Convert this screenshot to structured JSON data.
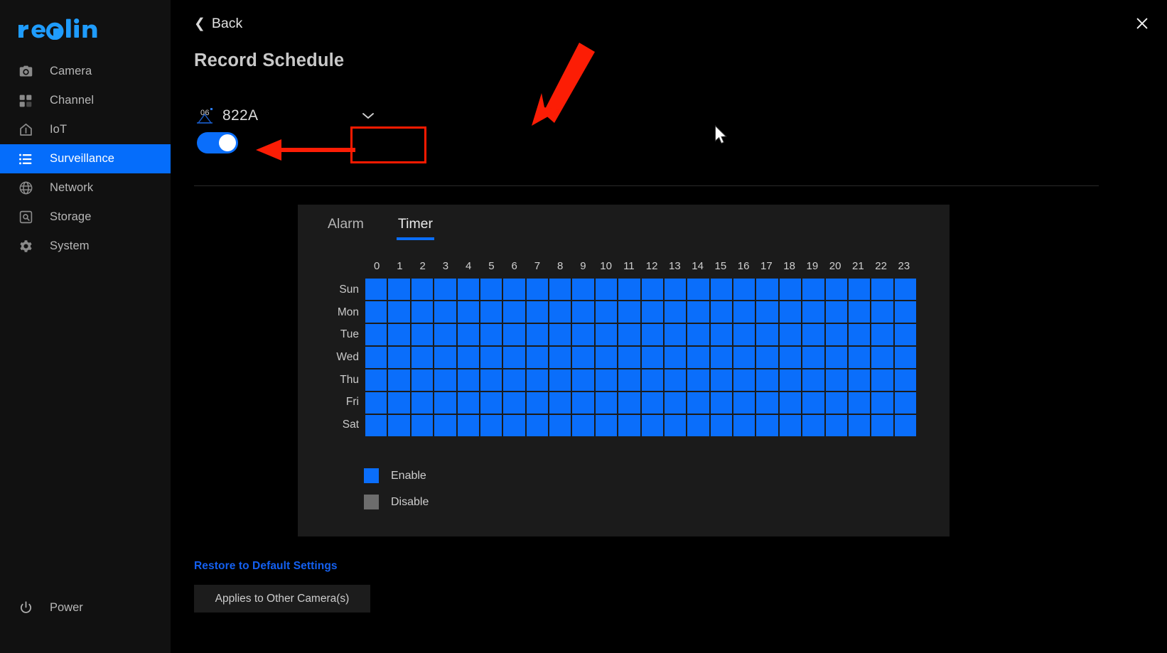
{
  "brand": {
    "name": "reolink",
    "color": "#1f9cfd"
  },
  "sidebar": {
    "items": [
      {
        "label": "Camera",
        "icon": "camera-icon",
        "active": false
      },
      {
        "label": "Channel",
        "icon": "channel-grid-icon",
        "active": false
      },
      {
        "label": "IoT",
        "icon": "home-iot-icon",
        "active": false
      },
      {
        "label": "Surveillance",
        "icon": "list-icon",
        "active": true
      },
      {
        "label": "Network",
        "icon": "globe-icon",
        "active": false
      },
      {
        "label": "Storage",
        "icon": "hard-disk-icon",
        "active": false
      },
      {
        "label": "System",
        "icon": "gear-icon",
        "active": false
      }
    ],
    "power": {
      "label": "Power",
      "icon": "power-icon"
    }
  },
  "header": {
    "back_label": "Back",
    "back_icon": "chevron-left-icon",
    "title": "Record Schedule",
    "close_icon": "close-icon"
  },
  "camera_selector": {
    "channel_number": "06",
    "channel_icon": "camera-channel-icon",
    "camera_name": "822A",
    "dropdown_icon": "chevron-down-icon",
    "enabled": true
  },
  "schedule": {
    "tabs": [
      {
        "label": "Alarm",
        "active": false
      },
      {
        "label": "Timer",
        "active": true
      }
    ],
    "active_color": "#0a6efb",
    "legend": [
      {
        "label": "Enable",
        "color": "#0a6efb"
      },
      {
        "label": "Disable",
        "color": "#6d6d6d"
      }
    ],
    "hours": [
      "0",
      "1",
      "2",
      "3",
      "4",
      "5",
      "6",
      "7",
      "8",
      "9",
      "10",
      "11",
      "12",
      "13",
      "14",
      "15",
      "16",
      "17",
      "18",
      "19",
      "20",
      "21",
      "22",
      "23"
    ],
    "days": [
      "Sun",
      "Mon",
      "Tue",
      "Wed",
      "Thu",
      "Fri",
      "Sat"
    ],
    "cells": [
      [
        1,
        1,
        1,
        1,
        1,
        1,
        1,
        1,
        1,
        1,
        1,
        1,
        1,
        1,
        1,
        1,
        1,
        1,
        1,
        1,
        1,
        1,
        1,
        1
      ],
      [
        1,
        1,
        1,
        1,
        1,
        1,
        1,
        1,
        1,
        1,
        1,
        1,
        1,
        1,
        1,
        1,
        1,
        1,
        1,
        1,
        1,
        1,
        1,
        1
      ],
      [
        1,
        1,
        1,
        1,
        1,
        1,
        1,
        1,
        1,
        1,
        1,
        1,
        1,
        1,
        1,
        1,
        1,
        1,
        1,
        1,
        1,
        1,
        1,
        1
      ],
      [
        1,
        1,
        1,
        1,
        1,
        1,
        1,
        1,
        1,
        1,
        1,
        1,
        1,
        1,
        1,
        1,
        1,
        1,
        1,
        1,
        1,
        1,
        1,
        1
      ],
      [
        1,
        1,
        1,
        1,
        1,
        1,
        1,
        1,
        1,
        1,
        1,
        1,
        1,
        1,
        1,
        1,
        1,
        1,
        1,
        1,
        1,
        1,
        1,
        1
      ],
      [
        1,
        1,
        1,
        1,
        1,
        1,
        1,
        1,
        1,
        1,
        1,
        1,
        1,
        1,
        1,
        1,
        1,
        1,
        1,
        1,
        1,
        1,
        1,
        1
      ],
      [
        1,
        1,
        1,
        1,
        1,
        1,
        1,
        1,
        1,
        1,
        1,
        1,
        1,
        1,
        1,
        1,
        1,
        1,
        1,
        1,
        1,
        1,
        1,
        1
      ]
    ]
  },
  "footer": {
    "restore_label": "Restore to Default Settings",
    "apply_label": "Applies to Other Camera(s)"
  },
  "annotations": {
    "color": "#ff1a00"
  }
}
